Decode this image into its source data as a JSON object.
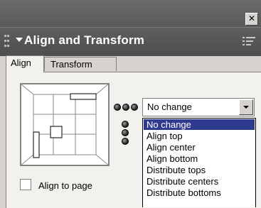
{
  "panel": {
    "close_glyph": "✕",
    "title": "Align and Transform"
  },
  "tabs": [
    {
      "label": "Align",
      "active": true
    },
    {
      "label": "Transform",
      "active": false
    }
  ],
  "align": {
    "to_page_label": "Align to page",
    "to_page_checked": false,
    "mode": {
      "value": "No change",
      "options": [
        "No change",
        "Align top",
        "Align center",
        "Align bottom",
        "Distribute tops",
        "Distribute centers",
        "Distribute bottoms"
      ],
      "highlighted": "No change"
    }
  },
  "colors": {
    "selection": "#2f3b8f",
    "header": "#555555"
  },
  "icons": [
    "close-icon",
    "gripper-icon",
    "collapse-arrow-icon",
    "panel-menu-icon",
    "dropdown-arrow-icon"
  ]
}
